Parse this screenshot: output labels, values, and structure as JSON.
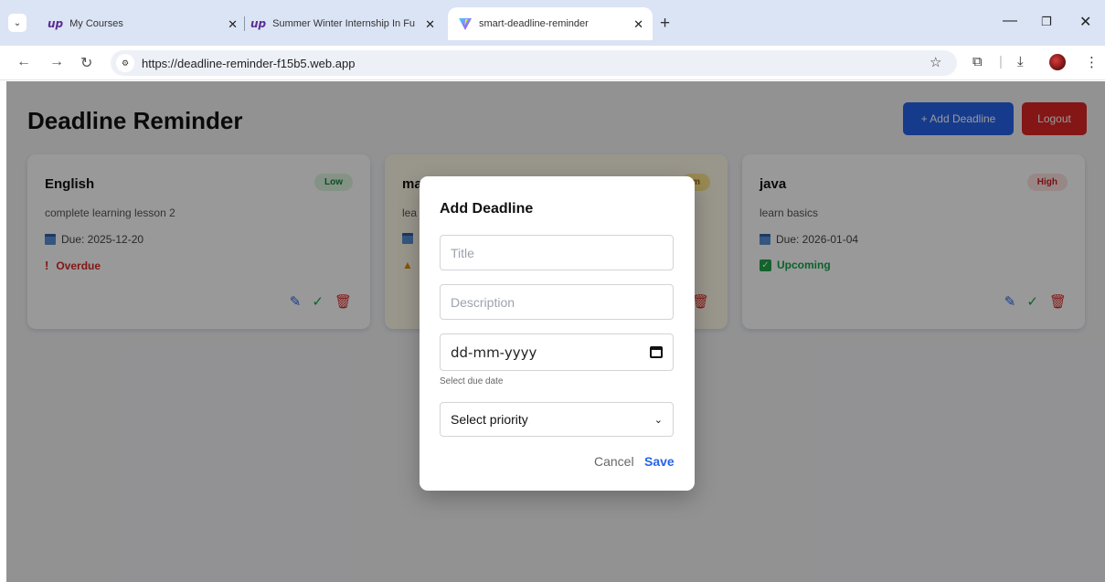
{
  "browser": {
    "tabs": [
      {
        "title": "My Courses",
        "favicon": "up"
      },
      {
        "title": "Summer Winter Internship In Fu",
        "favicon": "up"
      },
      {
        "title": "smart-deadline-reminder",
        "favicon": "vite-icon"
      }
    ],
    "url": "https://deadline-reminder-f15b5.web.app"
  },
  "header": {
    "title": "Deadline Reminder",
    "add_label": "+ Add Deadline",
    "logout_label": "Logout"
  },
  "cards": [
    {
      "title": "English",
      "priority": "Low",
      "description": "complete learning lesson 2",
      "due": "Due: 2025-12-20",
      "status": "Overdue"
    },
    {
      "title": "ma",
      "priority": "m",
      "description": "lea",
      "due": "",
      "status": ""
    },
    {
      "title": "java",
      "priority": "High",
      "description": "learn basics",
      "due": "Due: 2026-01-04",
      "status": "Upcoming"
    }
  ],
  "modal": {
    "title": "Add Deadline",
    "title_placeholder": "Title",
    "description_placeholder": "Description",
    "date_value": "dd-mm-yyyy",
    "date_hint": "Select due date",
    "priority_value": "Select priority",
    "cancel_label": "Cancel",
    "save_label": "Save"
  },
  "colors": {
    "primary": "#2563eb",
    "danger": "#dc2626",
    "success": "#16a34a"
  }
}
